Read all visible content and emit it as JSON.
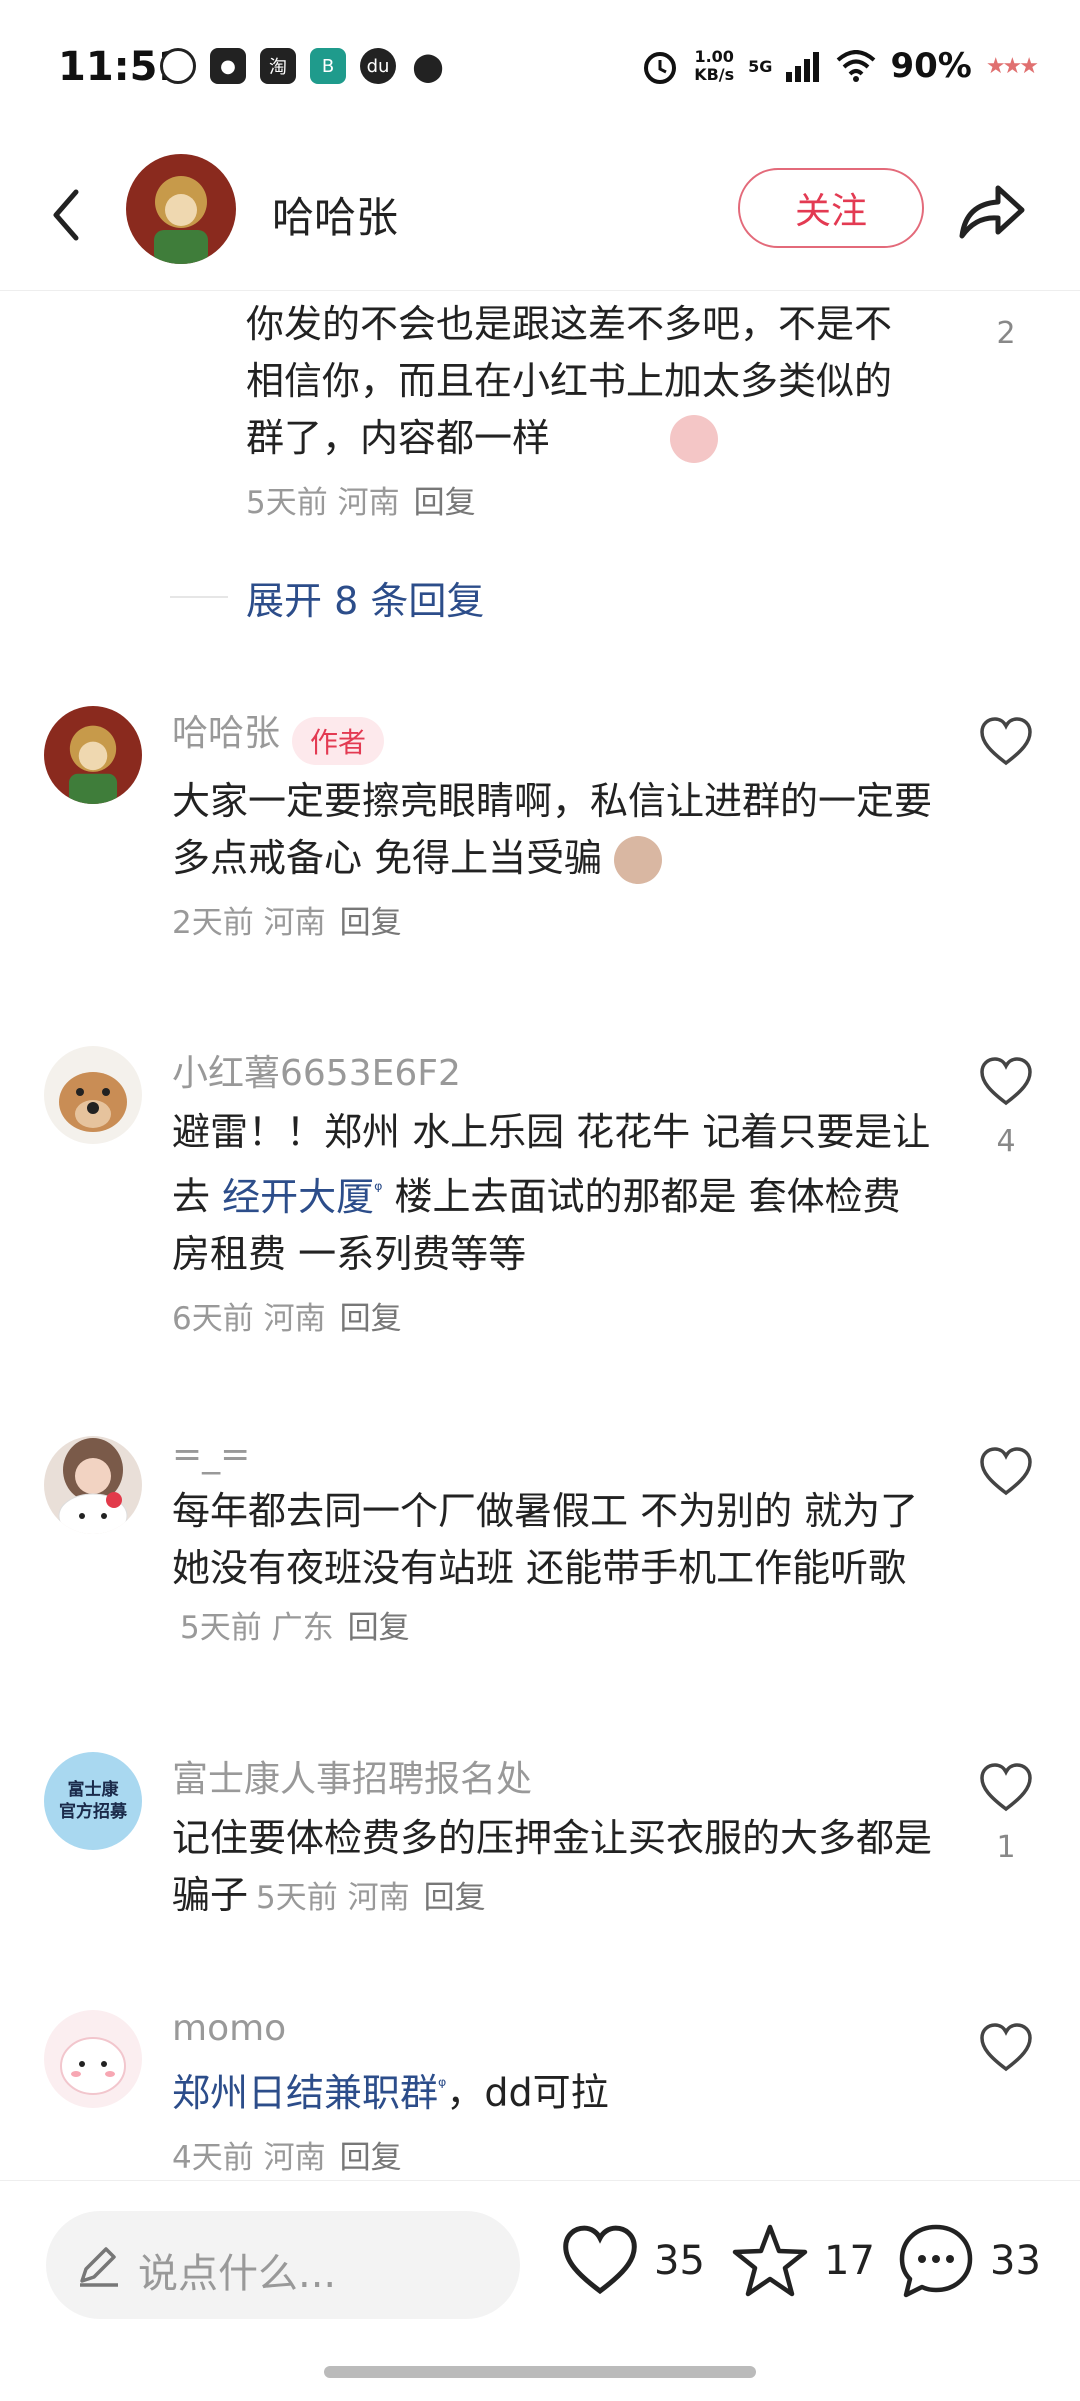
{
  "status_bar": {
    "time": "11:51",
    "net_speed": "1.00\nKB/s",
    "net_type": "5G",
    "battery": "90%"
  },
  "header": {
    "author_name": "哈哈张",
    "follow_label": "关注"
  },
  "thread": {
    "reply_text": "你发的不会也是跟这差不多吧，不是不相信你，而且在小红书上加太多类似的群了，内容都一样",
    "reply_meta": "5天前 河南",
    "reply_label": "回复",
    "like_count": "2",
    "expand_label": "展开 8 条回复"
  },
  "comments": [
    {
      "name": "哈哈张",
      "tag": "作者",
      "text": "大家一定要擦亮眼睛啊，私信让进群的一定要多点戒备心 免得上当受骗",
      "meta": "2天前 河南",
      "reply": "回复",
      "likes": ""
    },
    {
      "name": "小红薯6653E6F2",
      "text_before": "避雷！！郑州 水上乐园 花花牛 记着只要是让去 ",
      "link": "经开大厦",
      "text_after": " 楼上去面试的那都是 套体检费 房租费 一系列费等等",
      "meta": "6天前 河南",
      "reply": "回复",
      "likes": "4"
    },
    {
      "name": "=_=",
      "text": "每年都去同一个厂做暑假工 不为别的 就为了她没有夜班没有站班 还能带手机工作能听歌",
      "meta": "5天前 广东",
      "reply": "回复",
      "likes": ""
    },
    {
      "name": "富士康人事招聘报名处",
      "avatar_text": "富士康\n官方招募",
      "text": "记住要体检费多的压押金让买衣服的大多都是骗子",
      "meta": "5天前 河南",
      "reply": "回复",
      "likes": "1"
    },
    {
      "name": "momo",
      "link": "郑州日结兼职群",
      "text_after": "，dd可拉",
      "meta": "4天前 河南",
      "reply": "回复",
      "likes": ""
    }
  ],
  "bottom_bar": {
    "input_placeholder": "说点什么...",
    "likes": "35",
    "favorites": "17",
    "comments": "33"
  },
  "colors": {
    "accent": "#e33a52",
    "link": "#2c4d8a"
  }
}
